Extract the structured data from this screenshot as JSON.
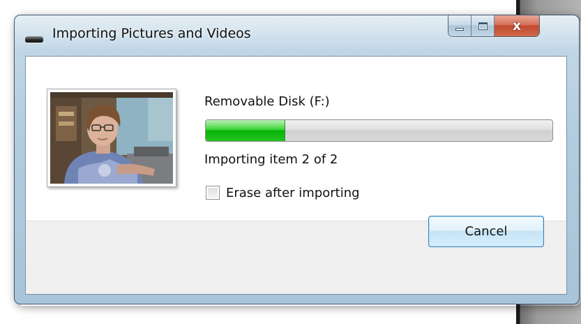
{
  "window": {
    "title": "Importing Pictures and Videos",
    "title_icon": "removable-drive-icon",
    "caption_buttons": {
      "minimize_icon": "minimize-icon",
      "maximize_icon": "maximize-icon",
      "close_glyph": "x",
      "close_icon": "close-icon"
    }
  },
  "content": {
    "thumbnail": "photo-thumbnail",
    "device_name": "Removable Disk (F:)",
    "progress": {
      "fraction": 0.23,
      "color": "#20c01c"
    },
    "status": "Importing item 2 of 2",
    "erase_option": {
      "label": "Erase after importing",
      "checked": false
    }
  },
  "footer": {
    "cancel_label": "Cancel"
  }
}
